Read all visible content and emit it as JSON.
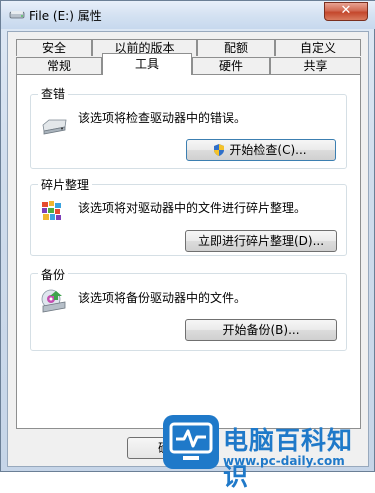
{
  "window": {
    "title": "File (E:) 属性",
    "close_label": "✕"
  },
  "tabs_row1": [
    {
      "label": "安全"
    },
    {
      "label": "以前的版本"
    },
    {
      "label": "配额"
    },
    {
      "label": "自定义"
    }
  ],
  "tabs_row2": [
    {
      "label": "常规"
    },
    {
      "label": "工具"
    },
    {
      "label": "硬件"
    },
    {
      "label": "共享"
    }
  ],
  "selected_tab": "工具",
  "sections": {
    "check": {
      "label": "查错",
      "description": "该选项将检查驱动器中的错误。",
      "button": "开始检查(C)..."
    },
    "defrag": {
      "label": "碎片整理",
      "description": "该选项将对驱动器中的文件进行碎片整理。",
      "button": "立即进行碎片整理(D)..."
    },
    "backup": {
      "label": "备份",
      "description": "该选项将备份驱动器中的文件。",
      "button": "开始备份(B)..."
    }
  },
  "footer": {
    "ok_partial": "确"
  },
  "watermark": {
    "title": "电脑百科知识",
    "url": "www.pc-daily.com",
    "color": "#1f79c9"
  },
  "colors": {
    "accent": "#1f79c9",
    "close": "#c4472c"
  }
}
